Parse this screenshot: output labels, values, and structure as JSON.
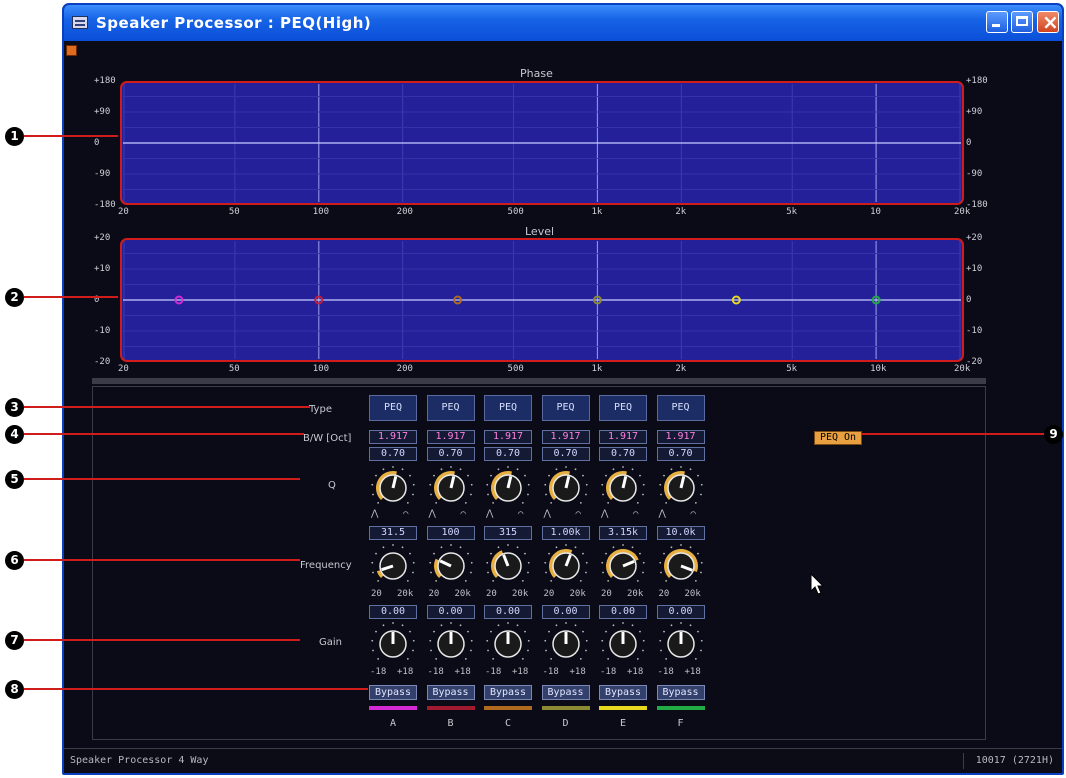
{
  "window": {
    "title": "Speaker Processor : PEQ(High)"
  },
  "phase_graph": {
    "title": "Phase",
    "y_labels": [
      "+180",
      "+90",
      "0",
      "-90",
      "-180"
    ],
    "x_labels": [
      "20",
      "50",
      "100",
      "200",
      "500",
      "1k",
      "2k",
      "5k",
      "10",
      "20k"
    ]
  },
  "level_graph": {
    "title": "Level",
    "y_labels": [
      "+20",
      "+10",
      "0",
      "-10",
      "-20"
    ],
    "x_labels": [
      "20",
      "50",
      "100",
      "200",
      "500",
      "1k",
      "2k",
      "5k",
      "10k",
      "20k"
    ],
    "band_points": [
      {
        "band": "A",
        "freq_hz": 31.5,
        "gain_db": 0,
        "color": "#d42ad4"
      },
      {
        "band": "B",
        "freq_hz": 100,
        "gain_db": 0,
        "color": "#c01e3c"
      },
      {
        "band": "C",
        "freq_hz": 315,
        "gain_db": 0,
        "color": "#b06a20"
      },
      {
        "band": "D",
        "freq_hz": 1000,
        "gain_db": 0,
        "color": "#8c8a34"
      },
      {
        "band": "E",
        "freq_hz": 3150,
        "gain_db": 0,
        "color": "#e8d820"
      },
      {
        "band": "F",
        "freq_hz": 10000,
        "gain_db": 0,
        "color": "#22aa44"
      }
    ]
  },
  "labels": {
    "type": "Type",
    "bw": "B/W [Oct]",
    "q": "Q",
    "frequency": "Frequency",
    "gain": "Gain"
  },
  "bands": [
    {
      "name": "A",
      "type": "PEQ",
      "bw": "1.917",
      "q": "0.70",
      "freq": "31.5",
      "gain": "0.00",
      "bypass": "Bypass",
      "color": "#d42ad4",
      "q_level": 0.55,
      "freq_level": 0.1,
      "gain_level": 0.5
    },
    {
      "name": "B",
      "type": "PEQ",
      "bw": "1.917",
      "q": "0.70",
      "freq": "100",
      "gain": "0.00",
      "bypass": "Bypass",
      "color": "#a01a30",
      "q_level": 0.55,
      "freq_level": 0.26,
      "gain_level": 0.5
    },
    {
      "name": "C",
      "type": "PEQ",
      "bw": "1.917",
      "q": "0.70",
      "freq": "315",
      "gain": "0.00",
      "bypass": "Bypass",
      "color": "#b06a20",
      "q_level": 0.55,
      "freq_level": 0.42,
      "gain_level": 0.5
    },
    {
      "name": "D",
      "type": "PEQ",
      "bw": "1.917",
      "q": "0.70",
      "freq": "1.00k",
      "gain": "0.00",
      "bypass": "Bypass",
      "color": "#8c8a34",
      "q_level": 0.55,
      "freq_level": 0.58,
      "gain_level": 0.5
    },
    {
      "name": "E",
      "type": "PEQ",
      "bw": "1.917",
      "q": "0.70",
      "freq": "3.15k",
      "gain": "0.00",
      "bypass": "Bypass",
      "color": "#e8d820",
      "q_level": 0.55,
      "freq_level": 0.75,
      "gain_level": 0.5
    },
    {
      "name": "F",
      "type": "PEQ",
      "bw": "1.917",
      "q": "0.70",
      "freq": "10.0k",
      "gain": "0.00",
      "bypass": "Bypass",
      "color": "#22aa44",
      "q_level": 0.55,
      "freq_level": 0.91,
      "gain_level": 0.5
    }
  ],
  "ranges": {
    "q_symbols": [
      "⋀",
      "⌒"
    ],
    "freq_min": "20",
    "freq_max": "20k",
    "gain_min": "-18",
    "gain_max": "+18"
  },
  "peq_on": "PEQ On",
  "status": {
    "left": "Speaker Processor   4 Way",
    "right": "10017 (2721H)"
  },
  "callouts": [
    "1",
    "2",
    "3",
    "4",
    "5",
    "6",
    "7",
    "8",
    "9"
  ],
  "colors": {
    "graph_fill": "#23209a",
    "graph_border": "#d01c1c",
    "knob_arc": "#e8b040"
  }
}
